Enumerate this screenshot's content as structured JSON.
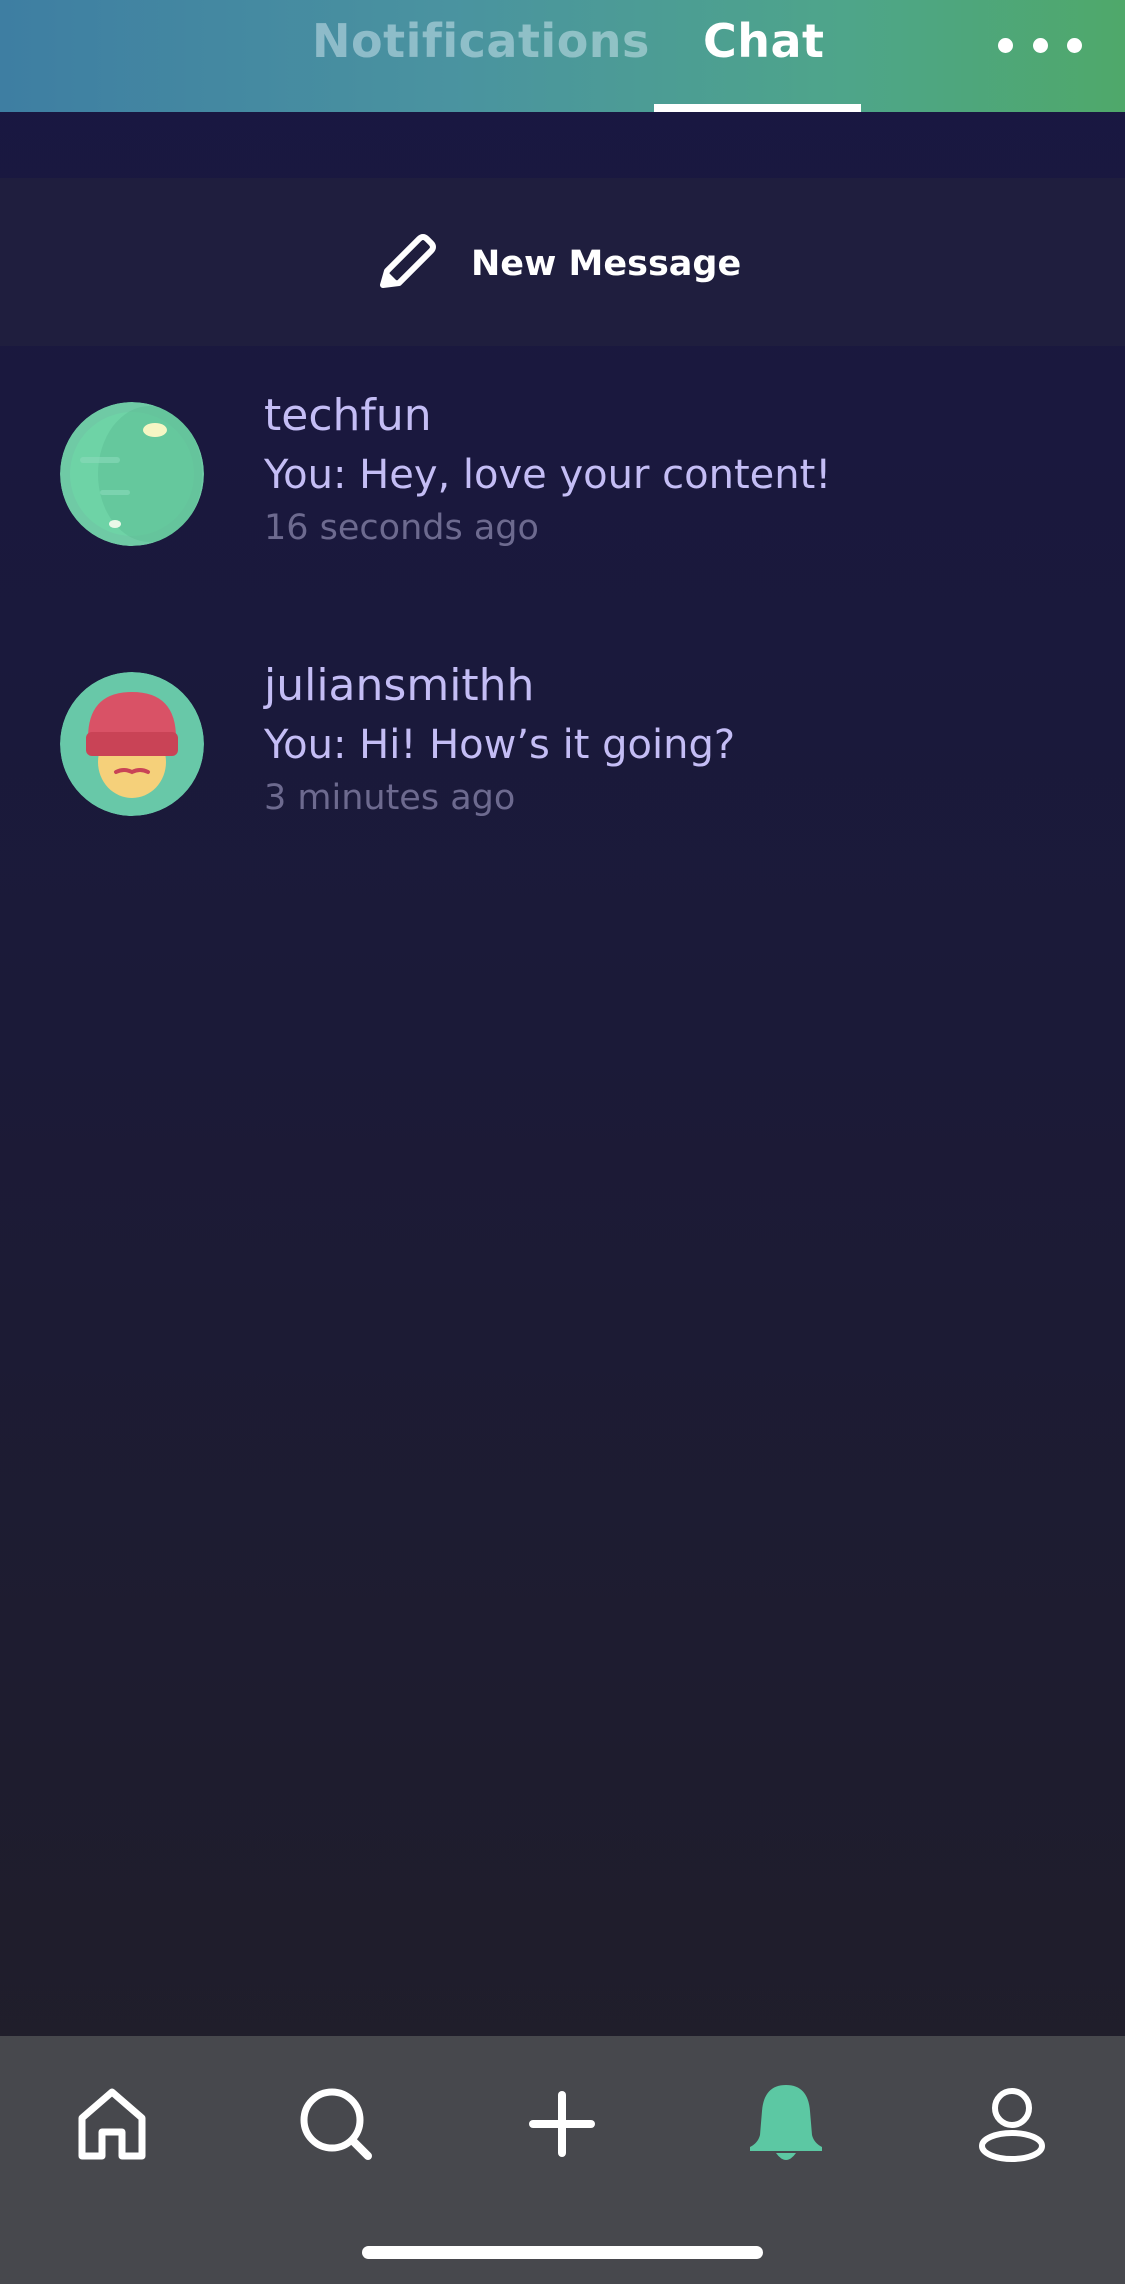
{
  "header": {
    "tabs": [
      {
        "label": "Notifications"
      },
      {
        "label": "Chat"
      }
    ],
    "more_icon": "more-horizontal-icon"
  },
  "new_message": {
    "label": "New Message",
    "icon": "pencil-icon"
  },
  "threads": [
    {
      "name": "techfun",
      "message": "You: Hey, love your content!",
      "time": "16 seconds ago"
    },
    {
      "name": "juliansmithh",
      "message": "You: Hi! How’s it going?",
      "time": "3 minutes ago"
    }
  ],
  "bottom_nav": {
    "items": [
      "home-icon",
      "search-icon",
      "plus-icon",
      "bell-icon",
      "profile-icon"
    ],
    "active": "bell-icon",
    "active_color": "#5cc8a3"
  },
  "colors": {
    "accent": "#5cc8a3",
    "name_text": "#c4bdf5",
    "time_text": "#6d6a8f"
  }
}
